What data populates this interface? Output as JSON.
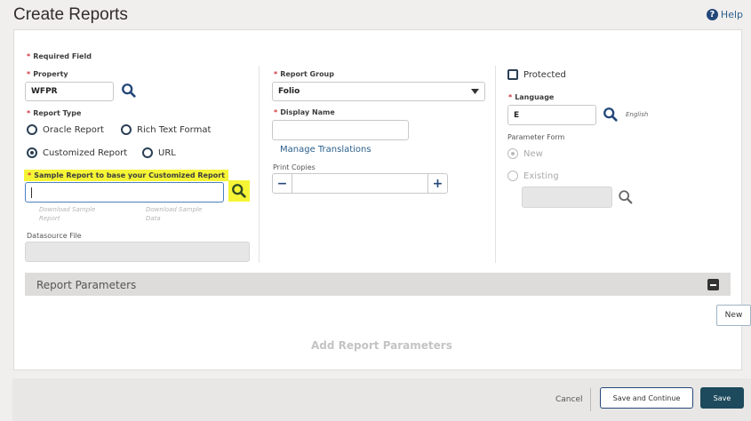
{
  "header": {
    "title": "Create Reports",
    "help_label": "Help"
  },
  "form": {
    "required_note": "Required Field",
    "property": {
      "label": "Property",
      "value": "WFPR"
    },
    "report_type": {
      "label": "Report Type",
      "options": [
        "Oracle Report",
        "Rich Text Format",
        "Customized Report",
        "URL"
      ],
      "selected": "Customized Report"
    },
    "sample_report": {
      "label": "Sample Report to base your Customized Report",
      "value": ""
    },
    "download_sample_report": "Download Sample Report",
    "download_sample_data": "Download Sample Data",
    "datasource_file": {
      "label": "Datasource File",
      "value": ""
    },
    "report_group": {
      "label": "Report Group",
      "value": "Folio"
    },
    "display_name": {
      "label": "Display Name",
      "value": ""
    },
    "manage_translations": "Manage Translations",
    "print_copies": {
      "label": "Print Copies",
      "value": ""
    },
    "protected": {
      "label": "Protected",
      "checked": false
    },
    "language": {
      "label": "Language",
      "value": "E",
      "description": "English"
    },
    "parameter_form": {
      "label": "Parameter Form",
      "options": [
        "New",
        "Existing"
      ],
      "selected": "New"
    }
  },
  "report_parameters": {
    "title": "Report Parameters",
    "empty_text": "Add Report Parameters",
    "new_label": "New"
  },
  "footer": {
    "cancel": "Cancel",
    "save_continue": "Save and Continue",
    "save": "Save"
  },
  "colors": {
    "accent": "#24477a",
    "highlight": "#f5f536",
    "required": "#d0363c",
    "save_button": "#1d4a5c"
  }
}
